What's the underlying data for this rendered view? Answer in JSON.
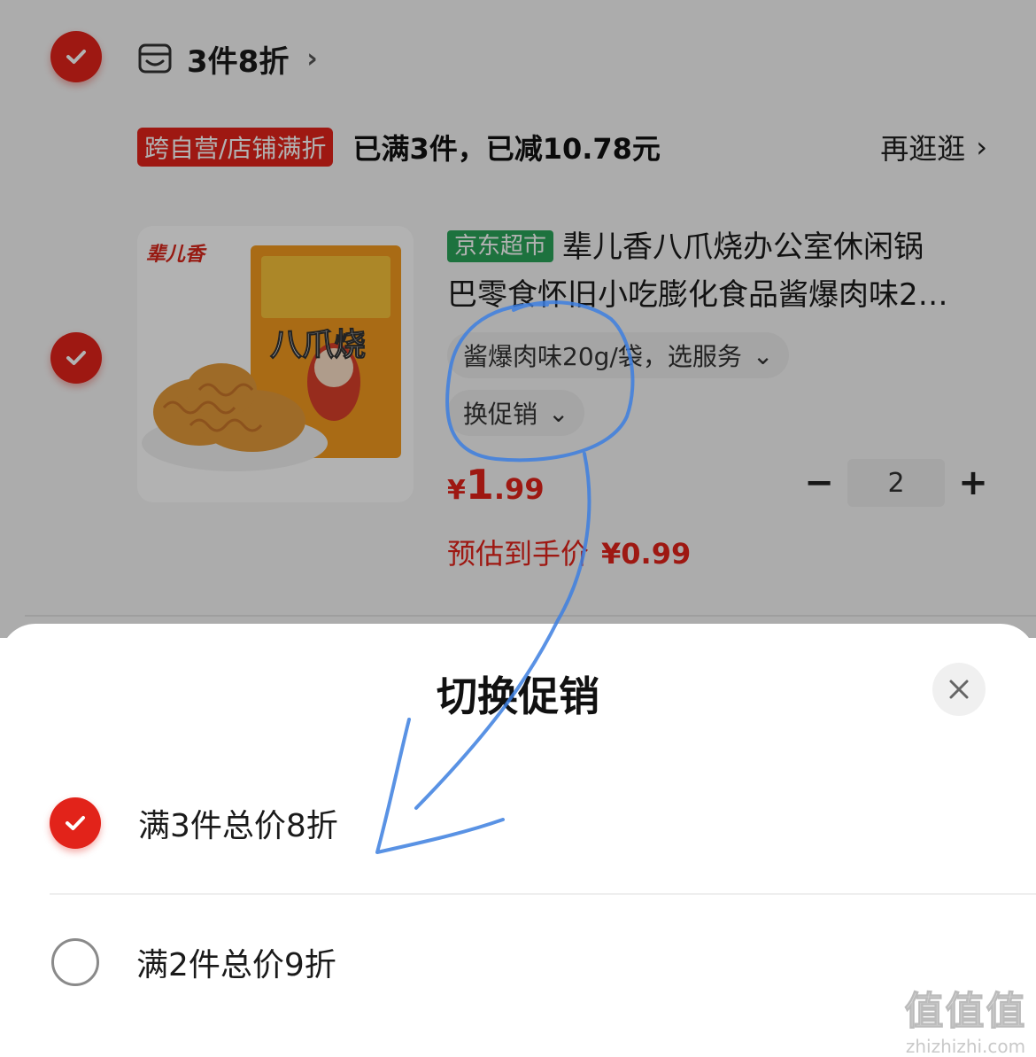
{
  "shop": {
    "name": "3件8折",
    "chevron": "›"
  },
  "promotion": {
    "tag": "跨自营/店铺满折",
    "status": "已满3件，已减10.78元",
    "more_label": "再逛逛",
    "more_chevron": "›"
  },
  "product": {
    "store_badge": "京东超市",
    "title_line1": "辈儿香八爪烧办公室休闲锅",
    "title_line2": "巴零食怀旧小吃膨化食品酱爆肉味2…",
    "image_brand": "辈儿香",
    "image_name": "八爪烧",
    "spec_label": "酱爆肉味20g/袋，选服务",
    "spec_chevron": "⌄",
    "promo_switch_label": "换促销",
    "promo_switch_chevron": "⌄",
    "price_symbol": "¥",
    "price_int": "1",
    "price_dec": ".99",
    "quantity": "2",
    "minus_label": "−",
    "plus_label": "+",
    "estimate_label": "预估到手价",
    "estimate_price": "¥0.99"
  },
  "sheet": {
    "title": "切换促销",
    "options": [
      {
        "label": "满3件总价8折",
        "selected": true
      },
      {
        "label": "满2件总价9折",
        "selected": false
      }
    ]
  },
  "watermark": {
    "big": "值值值",
    "small": "zhizhizhi.com"
  },
  "colors": {
    "accent": "#e2231a",
    "badge_green": "#2aa45a",
    "annotation_blue": "#3d7fe0"
  }
}
